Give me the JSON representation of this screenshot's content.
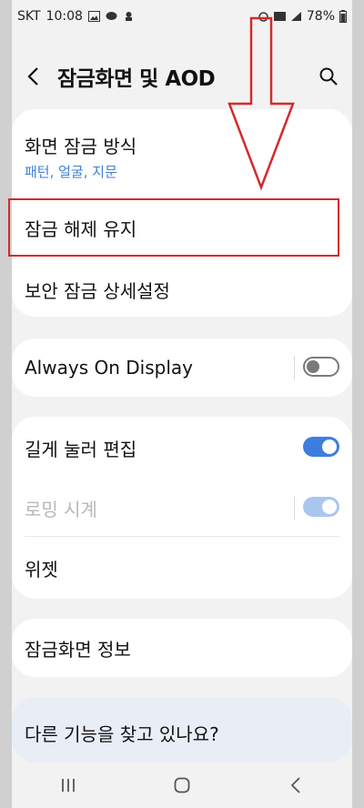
{
  "status_bar": {
    "carrier": "SKT",
    "time": "10:08",
    "battery": "78%"
  },
  "header": {
    "title": "잠금화면 및 AOD"
  },
  "lock_card": {
    "screen_lock_type": {
      "title": "화면 잠금 방식",
      "subtitle": "패턴, 얼굴, 지문"
    },
    "keep_unlocked": {
      "title": "잠금 해제 유지"
    },
    "secure_lock_settings": {
      "title": "보안 잠금 상세설정"
    }
  },
  "aod_card": {
    "aod": {
      "title": "Always On Display",
      "enabled": false
    }
  },
  "edit_card": {
    "long_press_edit": {
      "title": "길게 눌러 편집",
      "enabled": true
    },
    "roaming_clock": {
      "title": "로밍 시계",
      "enabled": true,
      "disabled": true
    },
    "widgets": {
      "title": "위젯"
    }
  },
  "about_card": {
    "about_lock_screen": {
      "title": "잠금화면 정보"
    }
  },
  "suggest_card": {
    "title": "다른 기능을 찾고 있나요?"
  },
  "colors": {
    "accent": "#3d7de0",
    "link": "#3e7fd1",
    "annotation": "#d42a2a"
  }
}
